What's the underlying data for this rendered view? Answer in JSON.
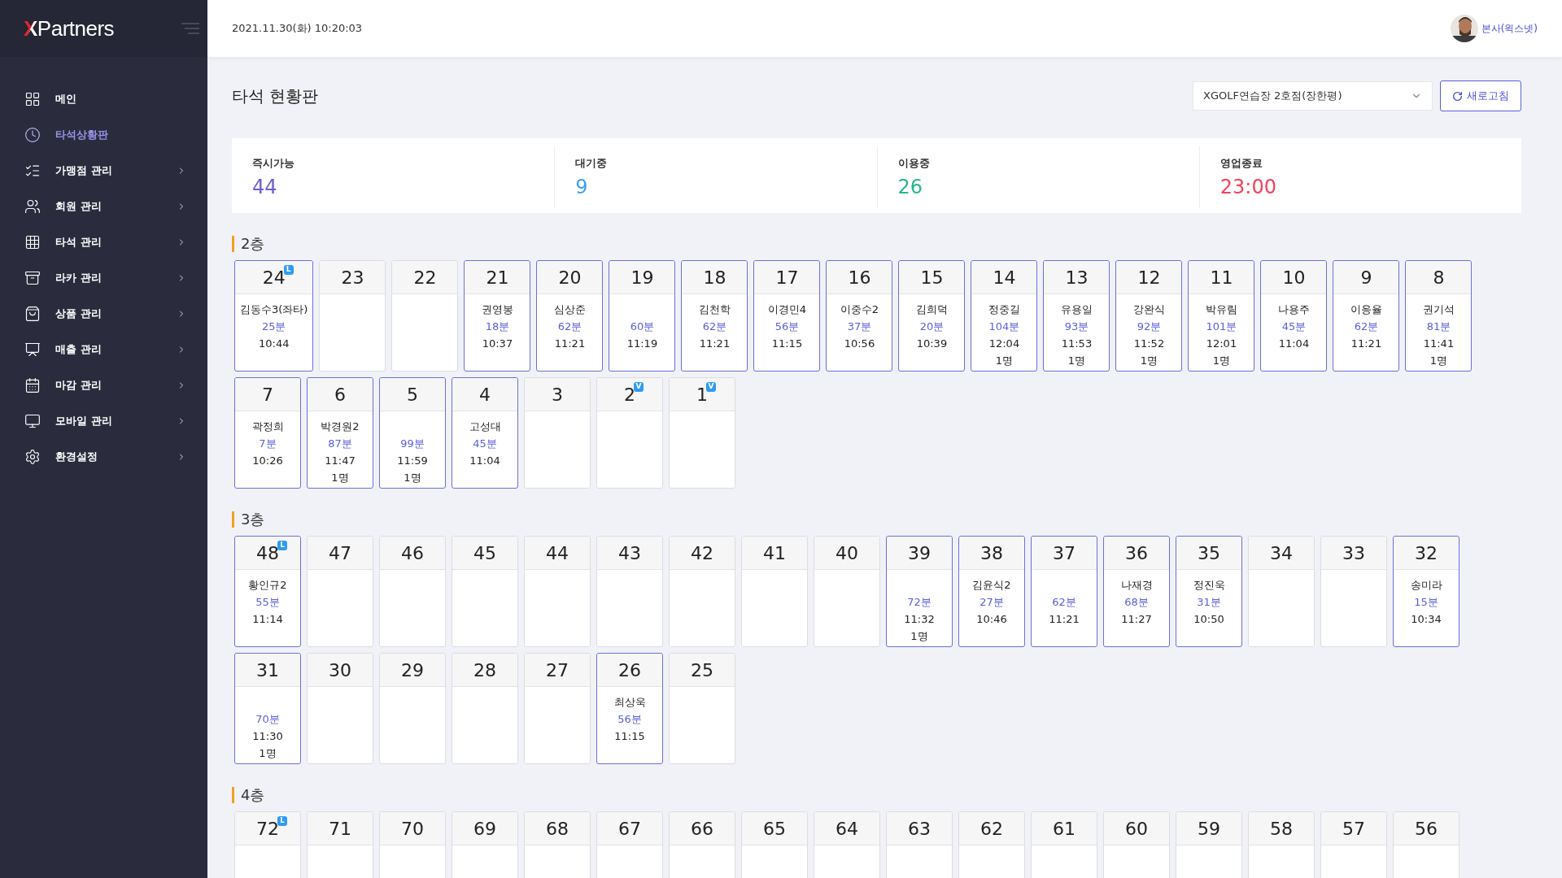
{
  "sidebar": {
    "logo": {
      "mark": "X",
      "text": "Partners"
    },
    "items": [
      {
        "label": "메인",
        "selected": false,
        "expandable": false
      },
      {
        "label": "타석상황판",
        "selected": true,
        "expandable": false
      },
      {
        "label": "가맹점 관리",
        "selected": false,
        "expandable": true
      },
      {
        "label": "회원 관리",
        "selected": false,
        "expandable": true
      },
      {
        "label": "타석 관리",
        "selected": false,
        "expandable": true
      },
      {
        "label": "라카 관리",
        "selected": false,
        "expandable": true
      },
      {
        "label": "상품 관리",
        "selected": false,
        "expandable": true
      },
      {
        "label": "매출 관리",
        "selected": false,
        "expandable": true
      },
      {
        "label": "마감 관리",
        "selected": false,
        "expandable": true
      },
      {
        "label": "모바일 관리",
        "selected": false,
        "expandable": true
      },
      {
        "label": "환경설정",
        "selected": false,
        "expandable": true
      }
    ]
  },
  "header": {
    "datetime": "2021.11.30(화) 10:20:03",
    "user": "본사(윅스넷)"
  },
  "page": {
    "title": "타석 현황판",
    "store_select": {
      "value": "XGOLF연습장 2호점(장한평)"
    },
    "refresh_button": "새로고침"
  },
  "stats": [
    {
      "label": "즉시가능",
      "value": "44",
      "color": "#6a5fd0"
    },
    {
      "label": "대기중",
      "value": "9",
      "color": "#3a9ff0"
    },
    {
      "label": "이용중",
      "value": "26",
      "color": "#27b48c"
    },
    {
      "label": "영업종료",
      "value": "23:00",
      "color": "#f2435b"
    }
  ],
  "floors": [
    {
      "label": "2층",
      "seats": [
        {
          "number": "24",
          "badge": "L",
          "occupied": true,
          "name": "김동수3(좌타)",
          "minutes": "25분",
          "time": "10:44"
        },
        {
          "number": "23",
          "occupied": false
        },
        {
          "number": "22",
          "occupied": false
        },
        {
          "number": "21",
          "occupied": true,
          "name": "권영봉",
          "minutes": "18분",
          "time": "10:37"
        },
        {
          "number": "20",
          "occupied": true,
          "name": "심상준",
          "minutes": "62분",
          "time": "11:21"
        },
        {
          "number": "19",
          "occupied": true,
          "minutes": "60분",
          "time": "11:19"
        },
        {
          "number": "18",
          "occupied": true,
          "name": "김천학",
          "minutes": "62분",
          "time": "11:21"
        },
        {
          "number": "17",
          "occupied": true,
          "name": "이경민4",
          "minutes": "56분",
          "time": "11:15"
        },
        {
          "number": "16",
          "occupied": true,
          "name": "이중수2",
          "minutes": "37분",
          "time": "10:56"
        },
        {
          "number": "15",
          "occupied": true,
          "name": "김희덕",
          "minutes": "20분",
          "time": "10:39"
        },
        {
          "number": "14",
          "occupied": true,
          "name": "정중길",
          "minutes": "104분",
          "time": "12:04",
          "count": "1명"
        },
        {
          "number": "13",
          "occupied": true,
          "name": "유용일",
          "minutes": "93분",
          "time": "11:53",
          "count": "1명"
        },
        {
          "number": "12",
          "occupied": true,
          "name": "강완식",
          "minutes": "92분",
          "time": "11:52",
          "count": "1명"
        },
        {
          "number": "11",
          "occupied": true,
          "name": "박유림",
          "minutes": "101분",
          "time": "12:01",
          "count": "1명"
        },
        {
          "number": "10",
          "occupied": true,
          "name": "나용주",
          "minutes": "45분",
          "time": "11:04"
        },
        {
          "number": "9",
          "occupied": true,
          "name": "이응율",
          "minutes": "62분",
          "time": "11:21"
        },
        {
          "number": "8",
          "occupied": true,
          "name": "권기석",
          "minutes": "81분",
          "time": "11:41",
          "count": "1명"
        },
        {
          "number": "7",
          "occupied": true,
          "name": "곽정희",
          "minutes": "7분",
          "time": "10:26"
        },
        {
          "number": "6",
          "occupied": true,
          "name": "박경원2",
          "minutes": "87분",
          "time": "11:47",
          "count": "1명"
        },
        {
          "number": "5",
          "occupied": true,
          "minutes": "99분",
          "time": "11:59",
          "count": "1명"
        },
        {
          "number": "4",
          "occupied": true,
          "name": "고성대",
          "minutes": "45분",
          "time": "11:04"
        },
        {
          "number": "3",
          "occupied": false
        },
        {
          "number": "2",
          "badge": "V",
          "occupied": false
        },
        {
          "number": "1",
          "badge": "V",
          "occupied": false
        }
      ]
    },
    {
      "label": "3층",
      "seats": [
        {
          "number": "48",
          "badge": "L",
          "occupied": true,
          "name": "황인규2",
          "minutes": "55분",
          "time": "11:14"
        },
        {
          "number": "47",
          "occupied": false
        },
        {
          "number": "46",
          "occupied": false
        },
        {
          "number": "45",
          "occupied": false
        },
        {
          "number": "44",
          "occupied": false
        },
        {
          "number": "43",
          "occupied": false
        },
        {
          "number": "42",
          "occupied": false
        },
        {
          "number": "41",
          "occupied": false
        },
        {
          "number": "40",
          "occupied": false
        },
        {
          "number": "39",
          "occupied": true,
          "minutes": "72분",
          "time": "11:32",
          "count": "1명"
        },
        {
          "number": "38",
          "occupied": true,
          "name": "김윤식2",
          "minutes": "27분",
          "time": "10:46"
        },
        {
          "number": "37",
          "occupied": true,
          "minutes": "62분",
          "time": "11:21"
        },
        {
          "number": "36",
          "occupied": true,
          "name": "나재경",
          "minutes": "68분",
          "time": "11:27"
        },
        {
          "number": "35",
          "occupied": true,
          "name": "정진욱",
          "minutes": "31분",
          "time": "10:50"
        },
        {
          "number": "34",
          "occupied": false
        },
        {
          "number": "33",
          "occupied": false
        },
        {
          "number": "32",
          "occupied": true,
          "name": "송미라",
          "minutes": "15분",
          "time": "10:34"
        },
        {
          "number": "31",
          "occupied": true,
          "minutes": "70분",
          "time": "11:30",
          "count": "1명"
        },
        {
          "number": "30",
          "occupied": false
        },
        {
          "number": "29",
          "occupied": false
        },
        {
          "number": "28",
          "occupied": false
        },
        {
          "number": "27",
          "occupied": false
        },
        {
          "number": "26",
          "occupied": true,
          "name": "최상욱",
          "minutes": "56분",
          "time": "11:15"
        },
        {
          "number": "25",
          "occupied": false
        }
      ]
    },
    {
      "label": "4층",
      "seats": [
        {
          "number": "72",
          "badge": "L",
          "occupied": false
        },
        {
          "number": "71",
          "occupied": false
        },
        {
          "number": "70",
          "occupied": false
        },
        {
          "number": "69",
          "occupied": false
        },
        {
          "number": "68",
          "occupied": false
        },
        {
          "number": "67",
          "occupied": false
        },
        {
          "number": "66",
          "occupied": false
        },
        {
          "number": "65",
          "occupied": false
        },
        {
          "number": "64",
          "occupied": false
        },
        {
          "number": "63",
          "occupied": false
        },
        {
          "number": "62",
          "occupied": false
        },
        {
          "number": "61",
          "occupied": false
        },
        {
          "number": "60",
          "occupied": false
        },
        {
          "number": "59",
          "occupied": false
        },
        {
          "number": "58",
          "occupied": false
        },
        {
          "number": "57",
          "occupied": false
        },
        {
          "number": "56",
          "occupied": false
        }
      ]
    }
  ]
}
